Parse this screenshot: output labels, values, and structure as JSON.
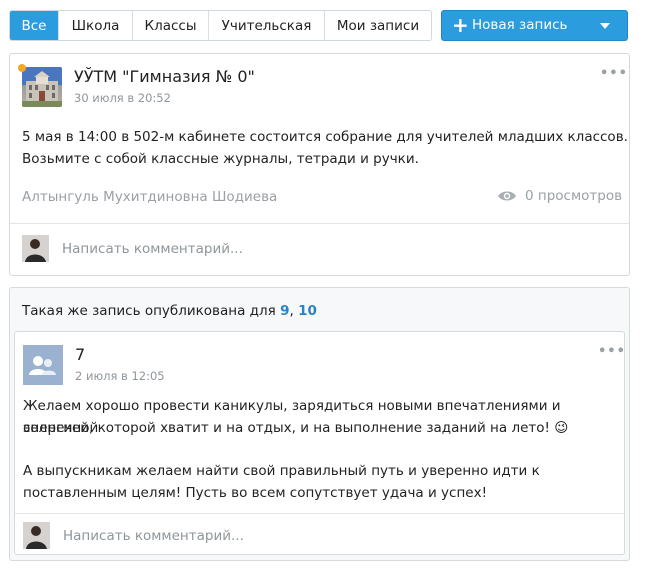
{
  "tabs": [
    {
      "label": "Все",
      "active": true
    },
    {
      "label": "Школа",
      "active": false
    },
    {
      "label": "Классы",
      "active": false
    },
    {
      "label": "Учительская",
      "active": false
    },
    {
      "label": "Мои записи",
      "active": false
    }
  ],
  "new_post": {
    "label": "Новая запись",
    "plus": "+"
  },
  "menu_glyph": "•••",
  "post1": {
    "author": "УЎТМ \"Гимназия № 0\"",
    "date": "30 июля в 20:52",
    "text_line1": "5 мая в 14:00 в 502-м кабинете состоится собрание для учителей младших классов.",
    "text_line2": "Возьмите с собой классные журналы, тетради и ручки.",
    "signature": "Алтынгуль Мухитдиновна Шодиева",
    "views": "0 просмотров",
    "comment_placeholder": "Написать комментарий..."
  },
  "shared": {
    "prefix": "Такая же запись опубликована для",
    "link1": "9",
    "separator": ",",
    "link2": "10"
  },
  "post2": {
    "author": "7",
    "date": "2 июля в 12:05",
    "text_line1": "Желаем хорошо провести каникулы, зарядиться новыми впечатлениями и солнечной",
    "text_line2": "энергией, которой хватит и на отдых, и на выполнение заданий на лето! 😉",
    "text_line3": "А выпускникам желаем найти свой правильный путь и уверенно идти к",
    "text_line4": "поставленным целям! Пусть во всем сопутствует удача и успех!",
    "comment_placeholder": "Написать комментарий..."
  },
  "colors": {
    "accent": "#2b9cdd",
    "unread": "#f5a623",
    "link": "#2b83c5"
  }
}
